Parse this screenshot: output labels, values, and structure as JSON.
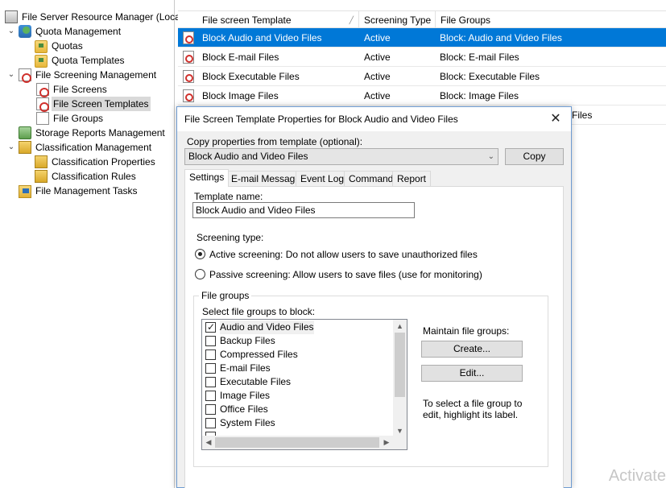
{
  "tree": {
    "root": "File Server Resource Manager (Loca",
    "items": [
      {
        "label": "Quota Management",
        "expanded": true,
        "icon": "quota-icon"
      },
      {
        "label": "Quotas",
        "icon": "folder-chart-icon"
      },
      {
        "label": "Quota Templates",
        "icon": "folder-chart-icon"
      },
      {
        "label": "File Screening Management",
        "expanded": true,
        "icon": "file-screen-icon"
      },
      {
        "label": "File Screens",
        "icon": "file-screen-icon"
      },
      {
        "label": "File Screen Templates",
        "selected": true,
        "icon": "file-screen-icon"
      },
      {
        "label": "File Groups",
        "icon": "document-icon"
      },
      {
        "label": "Storage Reports Management",
        "icon": "report-icon"
      },
      {
        "label": "Classification Management",
        "expanded": true,
        "icon": "classification-icon"
      },
      {
        "label": "Classification Properties",
        "icon": "classification-icon"
      },
      {
        "label": "Classification Rules",
        "icon": "classification-icon"
      },
      {
        "label": "File Management Tasks",
        "icon": "tasks-icon"
      }
    ]
  },
  "list": {
    "columns": [
      "File screen Template",
      "Screening Type",
      "File Groups"
    ],
    "rows": [
      {
        "template": "Block Audio and Video Files",
        "type": "Active",
        "groups": "Block: Audio and Video Files",
        "selected": true
      },
      {
        "template": "Block E-mail Files",
        "type": "Active",
        "groups": "Block: E-mail Files"
      },
      {
        "template": "Block Executable Files",
        "type": "Active",
        "groups": "Block: Executable Files"
      },
      {
        "template": "Block Image Files",
        "type": "Active",
        "groups": "Block: Image Files"
      }
    ],
    "partial_row_text": "Files"
  },
  "dialog": {
    "title": "File Screen Template Properties for Block Audio and Video Files",
    "copy_label": "Copy properties from template (optional):",
    "copy_value": "Block Audio and Video Files",
    "copy_button": "Copy",
    "tabs": [
      "Settings",
      "E-mail Message",
      "Event Log",
      "Command",
      "Report"
    ],
    "template_name_label": "Template name:",
    "template_name_value": "Block Audio and Video Files",
    "screening_type_label": "Screening type:",
    "active_label": "Active screening: Do not allow users to save unauthorized files",
    "passive_label": "Passive screening: Allow users to save files (use for monitoring)",
    "file_groups_legend": "File groups",
    "select_label": "Select file groups to block:",
    "file_groups": [
      {
        "label": "Audio and Video Files",
        "checked": true
      },
      {
        "label": "Backup Files",
        "checked": false
      },
      {
        "label": "Compressed Files",
        "checked": false
      },
      {
        "label": "E-mail Files",
        "checked": false
      },
      {
        "label": "Executable Files",
        "checked": false
      },
      {
        "label": "Image Files",
        "checked": false
      },
      {
        "label": "Office Files",
        "checked": false
      },
      {
        "label": "System Files",
        "checked": false
      }
    ],
    "maintain_label": "Maintain file groups:",
    "create_button": "Create...",
    "edit_button": "Edit...",
    "hint": "To select a file group to edit, highlight its label."
  },
  "watermark": "Activate"
}
